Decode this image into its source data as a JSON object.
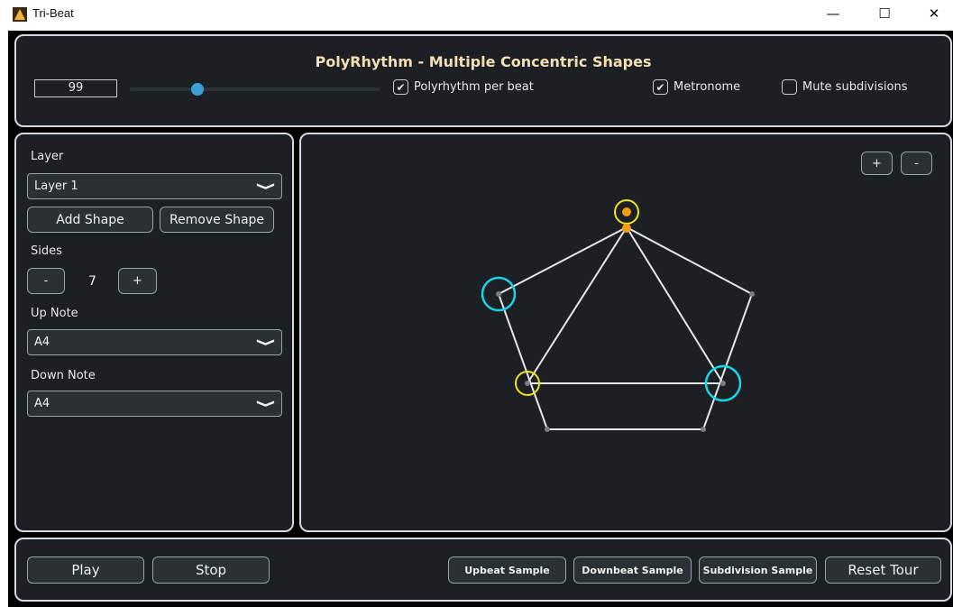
{
  "window": {
    "title": "Tri-Beat",
    "controls": {
      "minimize": "—",
      "maximize": "☐",
      "close": "✕"
    }
  },
  "header": {
    "title": "PolyRhythm - Multiple Concentric Shapes",
    "bpm_value": "99",
    "tempo_slider_fraction": 0.27,
    "polyrhythm_per_beat": {
      "label": "Polyrhythm per beat",
      "checked": true
    },
    "metronome": {
      "label": "Metronome",
      "checked": true
    },
    "mute_subdivisions": {
      "label": "Mute subdivisions",
      "checked": false
    }
  },
  "sidebar": {
    "layer_label": "Layer",
    "layer_selected": "Layer 1",
    "add_shape": "Add Shape",
    "remove_shape": "Remove Shape",
    "sides_label": "Sides",
    "sides_minus": "-",
    "sides_value": "7",
    "sides_plus": "+",
    "up_note_label": "Up Note",
    "up_note_selected": "A4",
    "down_note_label": "Down Note",
    "down_note_selected": "A4"
  },
  "canvas": {
    "zoom_in": "+",
    "zoom_out": "-"
  },
  "footer": {
    "play": "Play",
    "stop": "Stop",
    "upbeat_sample": "Upbeat Sample",
    "downbeat_sample": "Downbeat Sample",
    "subdivision_sample": "Subdivision Sample",
    "reset_tour": "Reset Tour"
  },
  "colors": {
    "background": "#000000",
    "panel": "#1c1f23",
    "panel_border": "#d5d9df",
    "title": "#f3dfb4",
    "accent_blue": "#3aa0d4",
    "highlight_yellow": "#f2e21a",
    "highlight_cyan": "#19d6e6",
    "marker_orange": "#f39c12",
    "shape_line": "#e6e6e6"
  }
}
